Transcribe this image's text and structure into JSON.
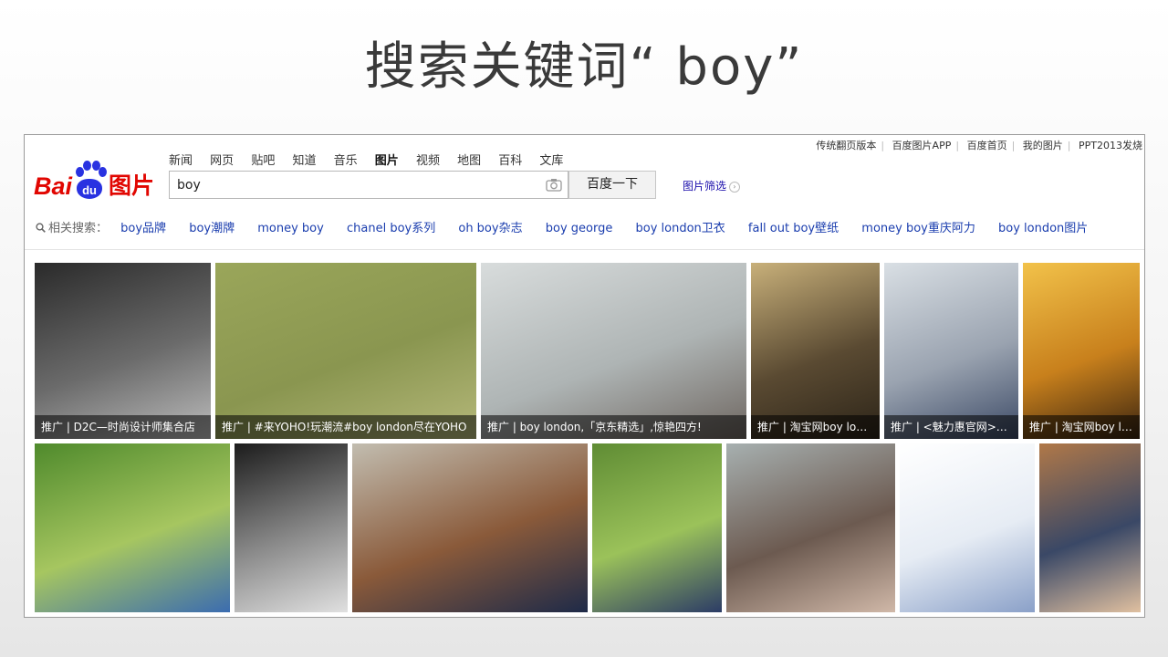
{
  "slide": {
    "title": "搜索关键词“ boy”"
  },
  "toplinks": [
    "传统翻页版本",
    "百度图片APP",
    "百度首页",
    "我的图片",
    "PPT2013发烧"
  ],
  "logo": {
    "bai": "Bai",
    "du": "du",
    "pic": "图片"
  },
  "nav": {
    "tabs": [
      "新闻",
      "网页",
      "贴吧",
      "知道",
      "音乐",
      "图片",
      "视频",
      "地图",
      "百科",
      "文库"
    ],
    "active": "图片"
  },
  "search": {
    "query": "boy",
    "button_label": "百度一下",
    "camera_icon": "camera-icon"
  },
  "filter": {
    "label": "图片筛选",
    "chevron": "›"
  },
  "related": {
    "label": "相关搜索：",
    "icon": "search-icon",
    "items": [
      "boy品牌",
      "boy潮牌",
      "money boy",
      "chanel boy系列",
      "oh boy杂志",
      "boy george",
      "boy london卫衣",
      "fall out boy壁纸",
      "money boy重庆阿力",
      "boy london图片"
    ]
  },
  "images": {
    "row1": [
      {
        "caption": "推广 | D2C—时尚设计师集合店",
        "image": "boy-london-hoodie-photo",
        "colors": [
          "#2a2a2a",
          "#6b6b6b",
          "#bdbdbd"
        ]
      },
      {
        "caption": "推广 | #来YOHO!玩潮流#boy london尽在YOHO",
        "image": "running-foal-on-grass-photo",
        "colors": [
          "#9aa65a",
          "#8a9650",
          "#b5b87a"
        ]
      },
      {
        "caption": "推广 | boy london,「京东精选」,惊艳四方!",
        "image": "boy-lying-on-bed-photo",
        "colors": [
          "#d8dcdc",
          "#aeb4b4",
          "#6e6660"
        ]
      },
      {
        "caption": "推广 | 淘宝网boy london",
        "image": "young-man-sunglasses-photo",
        "colors": [
          "#c8b07a",
          "#5a4a32",
          "#2c2418"
        ]
      },
      {
        "caption": "推广 | <魅力惠官网>正品",
        "image": "child-in-hoodie-photo",
        "colors": [
          "#d9dfe4",
          "#9aa3b0",
          "#3c4a66"
        ]
      },
      {
        "caption": "推广 | 淘宝网boy london",
        "image": "silhouette-at-sunset-photo",
        "colors": [
          "#f2c24a",
          "#c8801c",
          "#3a2410"
        ]
      }
    ],
    "row2": [
      {
        "image": "blond-boy-portrait-photo",
        "colors": [
          "#4f8a2c",
          "#a6c660",
          "#3b6cb0"
        ]
      },
      {
        "image": "black-and-white-boy-portrait-photo",
        "colors": [
          "#1c1c1c",
          "#8a8a8a",
          "#e0e0e0"
        ]
      },
      {
        "image": "boy-with-ukulele-photo",
        "colors": [
          "#c2bdb0",
          "#8a5a3a",
          "#1e2a48"
        ]
      },
      {
        "image": "toddler-in-striped-shirt-photo",
        "colors": [
          "#5f8c34",
          "#9bc25a",
          "#2c3c66"
        ]
      },
      {
        "image": "tattooed-young-man-photo",
        "colors": [
          "#a7b0b0",
          "#6c5a50",
          "#d0b8a8"
        ]
      },
      {
        "image": "boy-sketch-illustration",
        "colors": [
          "#ffffff",
          "#e6ecf4",
          "#8aa0c8"
        ]
      },
      {
        "image": "boy-on-leather-sofa-photo",
        "colors": [
          "#b07848",
          "#3a4866",
          "#e0c0a0"
        ]
      }
    ]
  }
}
